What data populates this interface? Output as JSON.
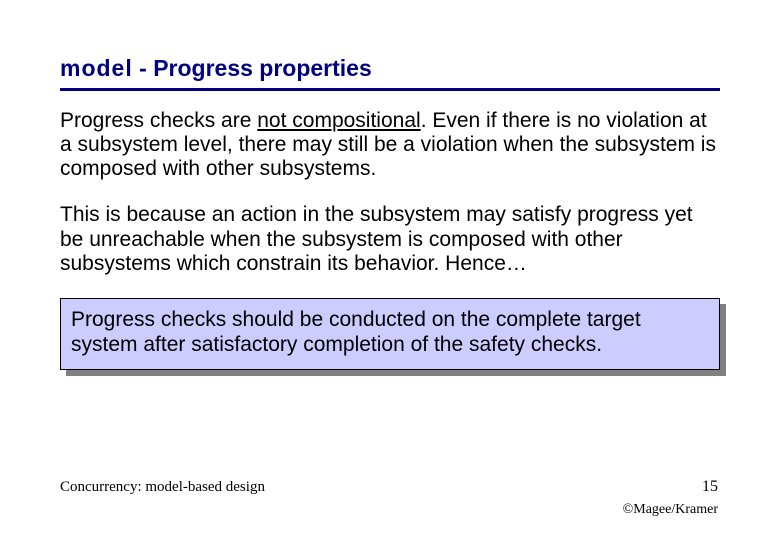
{
  "title": {
    "model": "model",
    "sep": "  - ",
    "rest": "Progress properties"
  },
  "p1": {
    "a": "Progress checks are ",
    "b": "not compositional",
    "c": ". Even if there is no violation at a subsystem level, there may still be a violation when the subsystem is composed with other subsystems."
  },
  "p2": "This is because an action in the subsystem may satisfy progress yet be unreachable when the subsystem is composed with other subsystems which constrain its behavior. Hence…",
  "box": "Progress checks should be conducted on the complete target system after satisfactory completion of the safety checks.",
  "footer": {
    "left": "Concurrency: model-based design",
    "page": "15",
    "copyright": "©Magee/Kramer"
  }
}
